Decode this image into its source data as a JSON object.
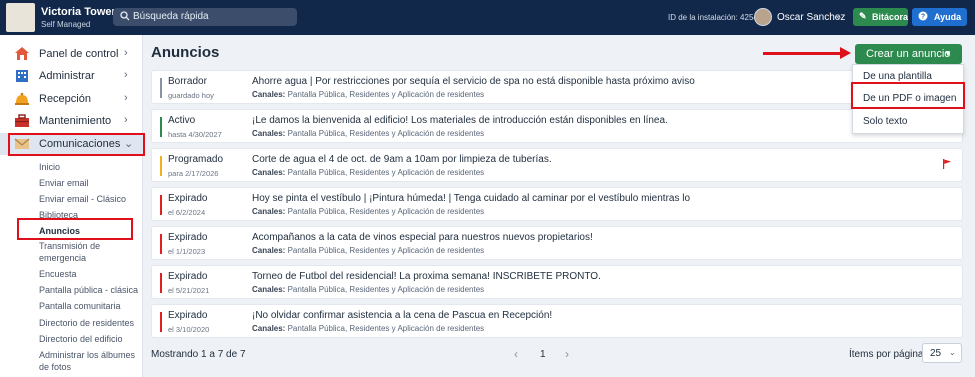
{
  "topbar": {
    "brand_name": "Victoria Towers",
    "brand_sub": "Self Managed",
    "search_placeholder": "Búsqueda rápida",
    "install_id": "ID de la instalación: 4254",
    "user_name": "Oscar Sanchez",
    "bitacora_label": "Bitácora",
    "ayuda_label": "Ayuda"
  },
  "sidebar": {
    "items": [
      {
        "label": "Panel de control",
        "icon": "house-icon"
      },
      {
        "label": "Administrar",
        "icon": "building-icon"
      },
      {
        "label": "Recepción",
        "icon": "bell-icon"
      },
      {
        "label": "Mantenimiento",
        "icon": "toolbox-icon"
      },
      {
        "label": "Comunicaciones",
        "icon": "mail-icon"
      }
    ],
    "sub_items": [
      "Inicio",
      "Enviar email",
      "Enviar email - Clásico",
      "Biblioteca",
      "Anuncios",
      "Transmisión de",
      "emergencia",
      "Encuesta",
      "Pantalla pública - clásica",
      "Pantalla comunitaria",
      "Directorio de residentes",
      "Directorio del edificio",
      "Administrar los álbumes",
      "de fotos"
    ]
  },
  "main": {
    "title": "Anuncios",
    "create_button": "Crear un anuncio",
    "dropdown": [
      "De una plantilla",
      "De un PDF o imagen",
      "Solo texto"
    ],
    "channels_label": "Canales:",
    "rows": [
      {
        "status": "Borrador",
        "date": "guardado hoy",
        "title": "Ahorre agua | Por restricciones por sequía el servicio de spa no está disponible hasta próximo aviso",
        "channels": "Pantalla Pública, Residentes y Aplicación de residentes",
        "color": "#8a93a3"
      },
      {
        "status": "Activo",
        "date": "hasta 4/30/2027",
        "title": "¡Le damos la bienvenida al edificio! Los materiales de introducción están disponibles en línea.",
        "channels": "Pantalla Pública, Residentes y Aplicación de residentes",
        "color": "#2d8a4e"
      },
      {
        "status": "Programado",
        "date": "para 2/17/2026",
        "title": "Corte de agua el 4 de oct. de 9am a 10am por limpieza de tuberías.",
        "channels": "Pantalla Pública, Residentes y Aplicación de residentes",
        "color": "#f2b01e"
      },
      {
        "status": "Expirado",
        "date": "el 6/2/2024",
        "title": "Hoy se pinta el vestíbulo | ¡Pintura húmeda! | Tenga cuidado al caminar por el vestíbulo mientras lo",
        "channels": "Pantalla Pública, Residentes y Aplicación de residentes",
        "color": "#e02020"
      },
      {
        "status": "Expirado",
        "date": "el 1/1/2023",
        "title": "Acompañanos a la cata de vinos especial para nuestros nuevos propietarios!",
        "channels": "Pantalla Pública, Residentes y Aplicación de residentes",
        "color": "#e02020"
      },
      {
        "status": "Expirado",
        "date": "el 5/21/2021",
        "title": "Torneo de Futbol del residencial! La proxima semana! INSCRIBETE PRONTO.",
        "channels": "Pantalla Pública, Residentes y Aplicación de residentes",
        "color": "#e02020"
      },
      {
        "status": "Expirado",
        "date": "el 3/10/2020",
        "title": "¡No olvidar confirmar asistencia a la cena de Pascua en Recepción!",
        "channels": "Pantalla Pública, Residentes y Aplicación de residentes",
        "color": "#e02020"
      }
    ]
  },
  "footer": {
    "count": "Mostrando 1 a 7 de 7",
    "page": "1",
    "per_page_label": "Ítems por página",
    "per_page_value": "25"
  }
}
